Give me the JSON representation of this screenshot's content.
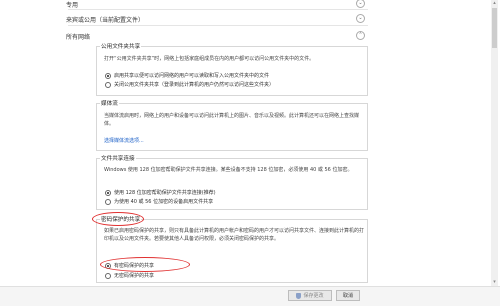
{
  "sections": {
    "private": "专用",
    "guest_public": "来宾或公用（当前配置文件）",
    "all_networks": "所有网络"
  },
  "public_folder": {
    "title": "公用文件夹共享",
    "desc": "打开“公用文件夹共享”时，网络上包括家庭组成员在内的用户都可以访问公用文件夹中的文件。",
    "opt_on": "启用共享以便可以访问网络的用户可以读取和写入公用文件夹中的文件",
    "opt_off": "关闭公用文件夹共享（登录到此计算机的用户仍然可以访问这些文件夹）"
  },
  "media": {
    "title": "媒体流",
    "desc": "当媒体流启用时，网络上的用户和设备可以访问此计算机上的图片、音乐以及视频。此计算机还可以在网络上查找媒体。",
    "link": "选择媒体流选项..."
  },
  "file_sharing": {
    "title": "文件共享连接",
    "desc": "Windows 使用 128 位加密帮助保护文件共享连接。某些设备不支持 128 位加密，必须使用 40 或 56 位加密。",
    "opt_128": "使用 128 位加密帮助保护文件共享连接(推荐)",
    "opt_40": "为使用 40 或 56 位加密的设备启用文件共享"
  },
  "password": {
    "title": "密码保护的共享",
    "desc": "如果已启用密码保护的共享，则只有具备此计算机的用户帐户和密码的用户才可以访问共享文件、连接到此计算机的打印机以及公用文件夹。若要使其他人具备访问权限，必须关闭密码保护的共享。",
    "opt_on": "有密码保护的共享",
    "opt_off": "无密码保护的共享"
  },
  "footer": {
    "save": "保存更改",
    "cancel": "取消"
  },
  "icons": {
    "chevron_down": "⌄",
    "chevron_up": "⌃",
    "scroll_up": "▴",
    "scroll_down": "▾"
  },
  "colors": {
    "highlight": "#e03030",
    "link": "#1a5fc7"
  }
}
